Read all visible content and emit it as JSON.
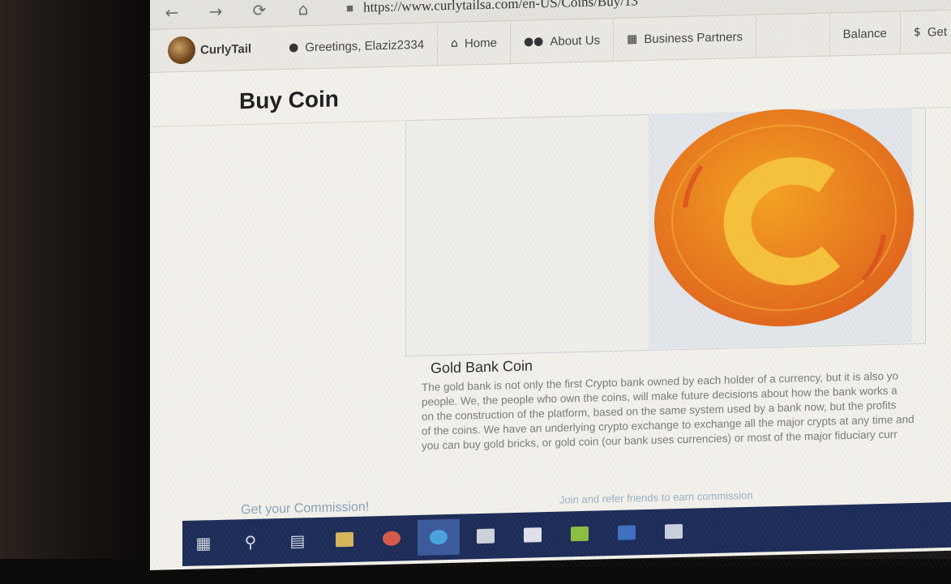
{
  "browser": {
    "url": "https://www.curlytailsa.com/en-US/Coins/Buy/13",
    "icons": [
      "back-icon",
      "forward-icon",
      "refresh-icon",
      "home-icon",
      "lock-icon"
    ]
  },
  "nav": {
    "logo_text": "CurlyTail",
    "greeting": "Greetings, Elaziz2334",
    "home": "Home",
    "about": "About Us",
    "partners": "Business Partners",
    "balance": "Balance",
    "get": "Get"
  },
  "page": {
    "title": "Buy Coin"
  },
  "coin": {
    "name": "Gold Bank Coin",
    "description_lines": [
      "The gold bank is not only the first Crypto bank owned by each holder of a currency, but it is also yo",
      "people. We, the people who own the coins, will make future decisions about how the bank works a",
      "on the construction of the platform, based on the same system used by a bank now, but the profits",
      "of the coins. We have an underlying crypto exchange to exchange all the major crypts at any time and",
      "you can buy gold bricks, or gold coin (our bank uses currencies) or most of the major fiduciary curr"
    ],
    "colors": {
      "outer": "#e8731a",
      "inner": "#f39a1e",
      "symbol": "#f7c13a"
    }
  },
  "footer": {
    "commission": "Get your Commission!",
    "commission_link": "Join and refer friends to earn commission"
  },
  "taskbar": {
    "items": [
      "start-icon",
      "search-icon",
      "task-view-icon",
      "file-explorer-icon",
      "chrome-icon",
      "edge-icon",
      "store-icon",
      "mail-icon",
      "minecraft-icon",
      "word-icon",
      "photos-icon"
    ],
    "active": "edge-icon"
  }
}
